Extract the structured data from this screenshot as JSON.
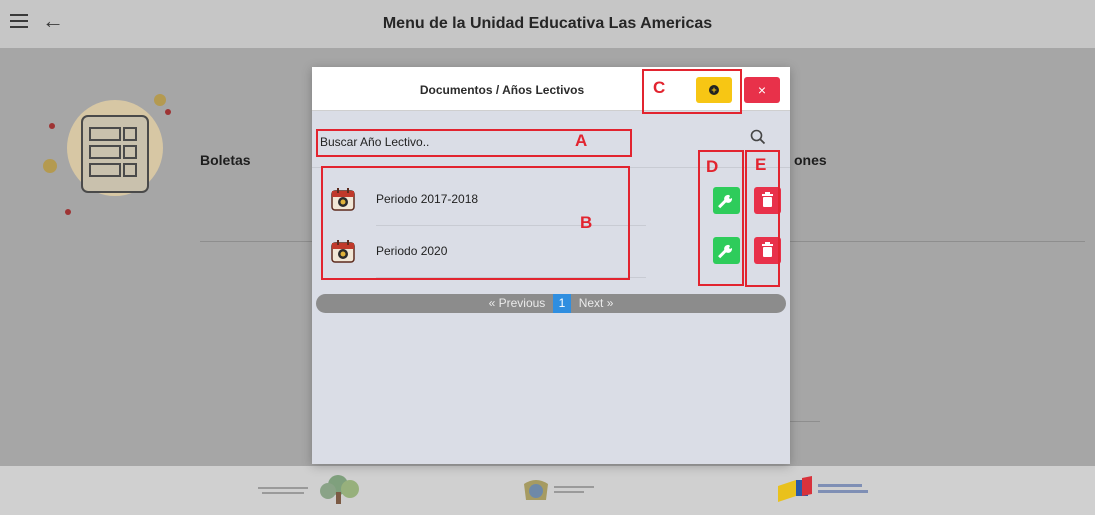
{
  "appbar": {
    "title": "Menu de la Unidad Educativa Las Americas",
    "menu_icon": "hamburger-icon",
    "back_icon": "back-arrow-icon"
  },
  "background": {
    "card_left_label": "Boletas",
    "card_right_label": "ones"
  },
  "modal": {
    "title": "Documentos / Años Lectivos",
    "add_button_icon": "plus-circle-icon",
    "close_button_label": "×",
    "search": {
      "placeholder": "Buscar Año Lectivo..",
      "icon": "search-icon"
    },
    "items": [
      {
        "label": "Periodo 2017-2018",
        "icon": "calendar-icon"
      },
      {
        "label": "Periodo 2020",
        "icon": "calendar-icon"
      }
    ],
    "pagination": {
      "prev": "« Previous",
      "current": "1",
      "next": "Next »"
    }
  },
  "annotations": [
    "A",
    "B",
    "C",
    "D",
    "E"
  ],
  "colors": {
    "add_button": "#f7c614",
    "close_button": "#e8314a",
    "edit_button": "#2ecc5b",
    "delete_button": "#e8314a",
    "annotation": "#e2242f",
    "pager_active": "#2f8ee0"
  }
}
